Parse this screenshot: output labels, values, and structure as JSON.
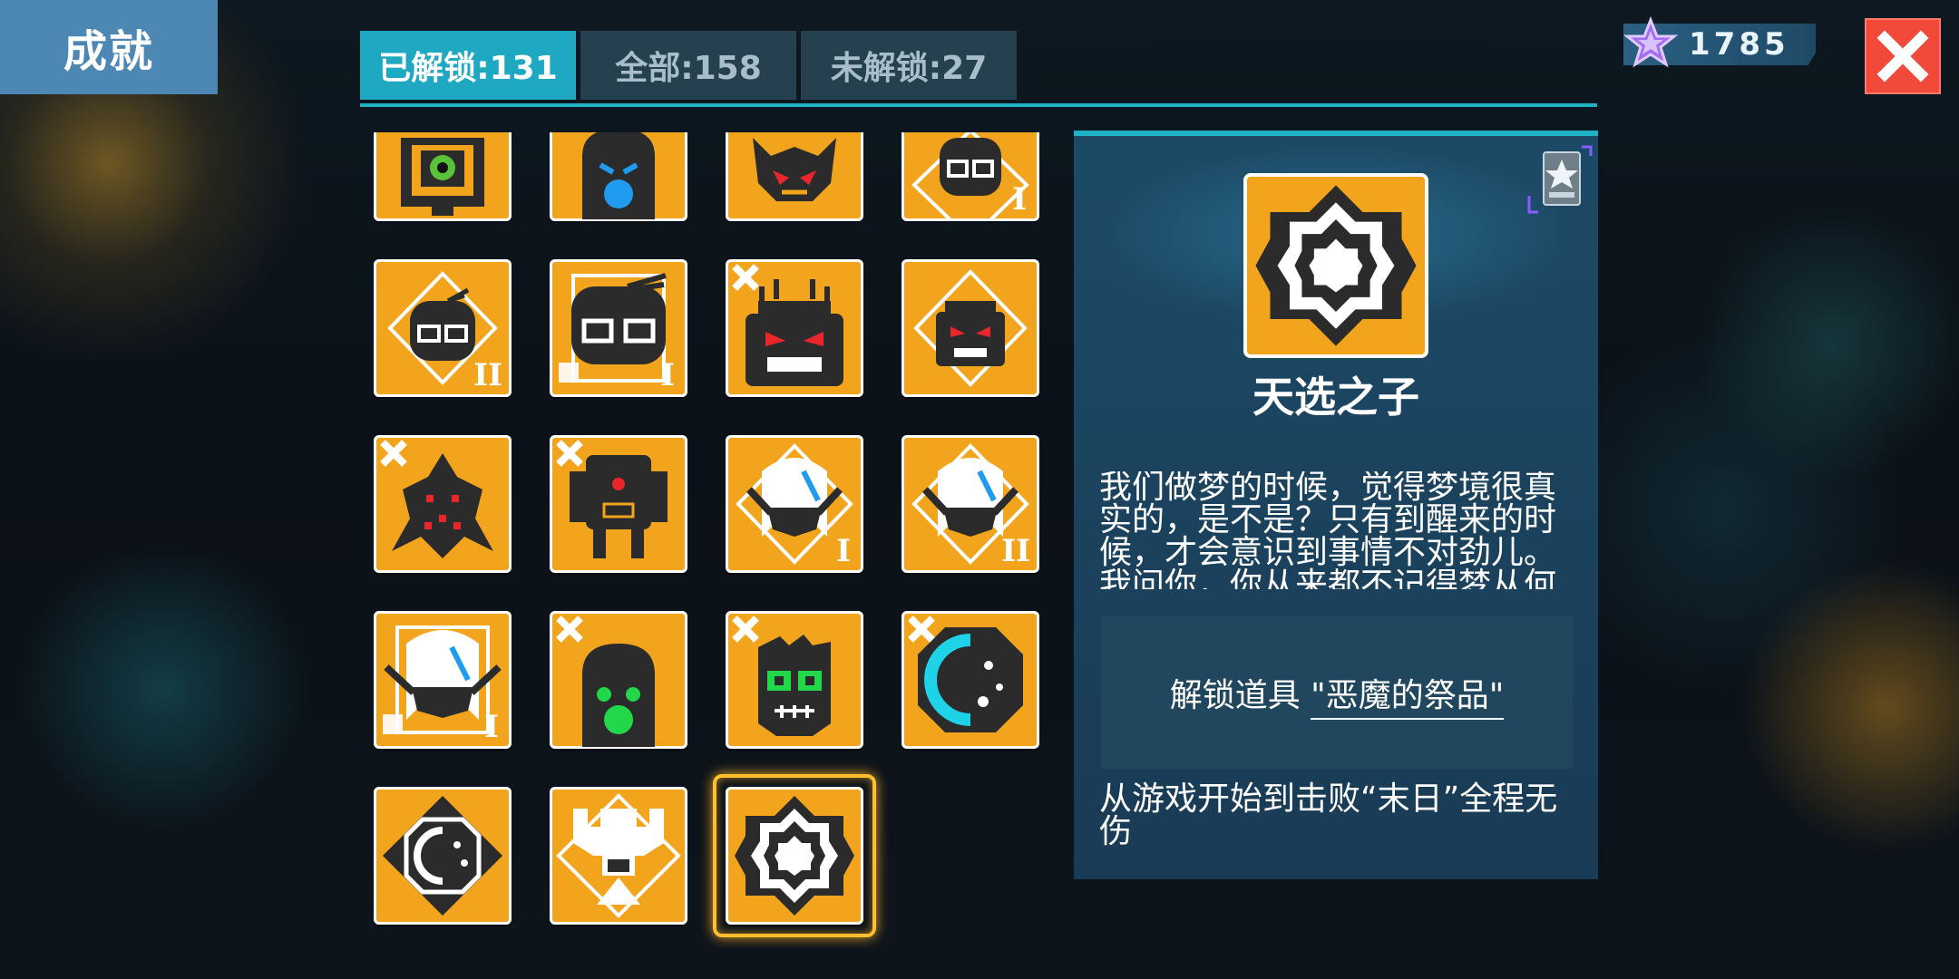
{
  "header": {
    "title": "成就"
  },
  "tabs": [
    {
      "label": "已解锁:131",
      "active": true
    },
    {
      "label": "全部:158",
      "active": false
    },
    {
      "label": "未解锁:27",
      "active": false
    }
  ],
  "currency": {
    "icon": "purple-star-icon",
    "value": "1785"
  },
  "close_icon": "close-icon",
  "colors": {
    "badge_orange": "#f2a41c",
    "tab_active": "#1fa8c2",
    "close_red": "#f24a3a",
    "panel_blue": "#1c4a66",
    "highlight": "#ffbf2f"
  },
  "badges": [
    {
      "icon": "turret-eye-badge-icon",
      "tier": "",
      "marked": false
    },
    {
      "icon": "blue-ghost-badge-icon",
      "tier": "",
      "marked": false
    },
    {
      "icon": "red-eyed-demon-badge-icon",
      "tier": "",
      "marked": false
    },
    {
      "icon": "goggles-knight-badge-icon",
      "tier": "I",
      "marked": false
    },
    {
      "icon": "goggles-knight-badge-icon",
      "tier": "II",
      "marked": false
    },
    {
      "icon": "goggles-knight-badge-icon",
      "tier": "I",
      "marked": false
    },
    {
      "icon": "red-eyed-robot-badge-icon",
      "tier": "",
      "marked": true
    },
    {
      "icon": "red-eyed-robot-badge-icon",
      "tier": "",
      "marked": false
    },
    {
      "icon": "spiked-creature-badge-icon",
      "tier": "",
      "marked": true
    },
    {
      "icon": "mech-walker-badge-icon",
      "tier": "",
      "marked": true
    },
    {
      "icon": "white-hair-hero-badge-icon",
      "tier": "I",
      "marked": false
    },
    {
      "icon": "white-hair-hero-badge-icon",
      "tier": "II",
      "marked": false
    },
    {
      "icon": "white-hair-hero-badge-icon",
      "tier": "I",
      "marked": false
    },
    {
      "icon": "green-ghost-badge-icon",
      "tier": "",
      "marked": true
    },
    {
      "icon": "green-eyed-zombie-badge-icon",
      "tier": "",
      "marked": true
    },
    {
      "icon": "cyan-orb-badge-icon",
      "tier": "",
      "marked": true
    },
    {
      "icon": "dark-orb-badge-icon",
      "tier": "",
      "marked": false
    },
    {
      "icon": "trophy-badge-icon",
      "tier": "",
      "marked": false
    },
    {
      "icon": "eight-point-star-badge-icon",
      "tier": "",
      "marked": false,
      "selected": true
    }
  ],
  "detail": {
    "icon": "eight-point-star-badge-icon",
    "corner_icon": "silver-star-card-icon",
    "name": "天选之子",
    "description": "我们做梦的时候，觉得梦境很真实的，是不是？只有到醒来的时候，才会意识到事情不对劲儿。我问你，你从来都不记得梦从何",
    "reward_prefix": "解锁道具 ",
    "reward_item": "\"恶魔的祭品\"",
    "condition": "从游戏开始到击败“末日”全程无伤"
  }
}
